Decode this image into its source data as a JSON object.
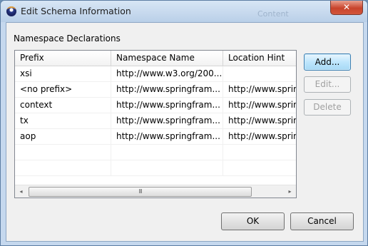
{
  "window": {
    "title": "Edit Schema Information",
    "background_title": "Content",
    "close_glyph": "✕"
  },
  "group": {
    "label": "Namespace Declarations"
  },
  "table": {
    "columns": [
      "Prefix",
      "Namespace Name",
      "Location Hint"
    ],
    "rows": [
      [
        "xsi",
        "http://www.w3.org/200...",
        ""
      ],
      [
        "<no prefix>",
        "http://www.springfram...",
        "http://www.sprin"
      ],
      [
        "context",
        "http://www.springfram...",
        "http://www.sprin"
      ],
      [
        "tx",
        "http://www.springfram...",
        "http://www.sprin"
      ],
      [
        "aop",
        "http://www.springfram...",
        "http://www.sprin"
      ],
      [
        "",
        "",
        ""
      ],
      [
        "",
        "",
        ""
      ]
    ],
    "scrollbar": {
      "left_arrow": "◂",
      "right_arrow": "▸",
      "grip": "III"
    }
  },
  "buttons": {
    "add": "Add...",
    "edit": "Edit...",
    "delete": "Delete",
    "ok": "OK",
    "cancel": "Cancel"
  },
  "icons": {
    "app": "eclipse-icon",
    "close": "close-icon"
  }
}
